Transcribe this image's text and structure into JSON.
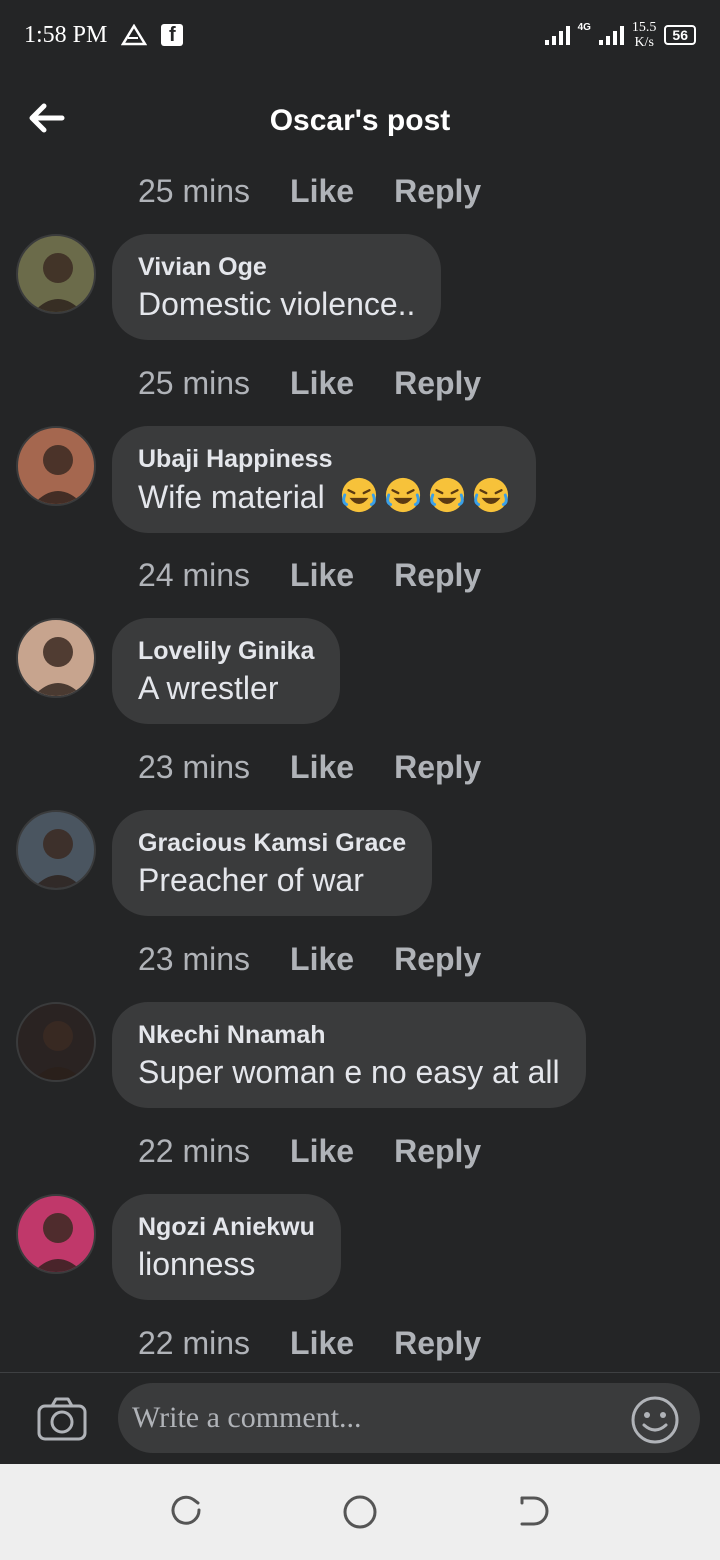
{
  "status_bar": {
    "time": "1:58 PM",
    "network": "4G",
    "speed_value": "15.5",
    "speed_unit": "K/s",
    "battery": "56"
  },
  "header": {
    "title": "Oscar's post",
    "back_icon": "arrow-left-icon"
  },
  "top_actions": {
    "time": "25 mins",
    "like": "Like",
    "reply": "Reply"
  },
  "comments": [
    {
      "name": "Vivian Oge",
      "text": "Domestic violence..",
      "time": "25 mins",
      "like": "Like",
      "reply": "Reply",
      "avatar_color": "#6b6b4a"
    },
    {
      "name": "Ubaji Happiness",
      "text": "Wife material ",
      "emoji": [
        "rolling-laughing-emoji",
        "rolling-laughing-emoji",
        "rolling-laughing-emoji",
        "rolling-laughing-emoji"
      ],
      "time": "24 mins",
      "like": "Like",
      "reply": "Reply",
      "avatar_color": "#a5674f"
    },
    {
      "name": "Lovelily Ginika",
      "text": "A wrestler",
      "time": "23 mins",
      "like": "Like",
      "reply": "Reply",
      "avatar_color": "#c7a48e"
    },
    {
      "name": "Gracious Kamsi Grace",
      "text": "Preacher of war",
      "time": "23 mins",
      "like": "Like",
      "reply": "Reply",
      "avatar_color": "#4a5560"
    },
    {
      "name": "Nkechi Nnamah",
      "text": "Super woman e no easy at all",
      "time": "22 mins",
      "like": "Like",
      "reply": "Reply",
      "avatar_color": "#2a2322"
    },
    {
      "name": "Ngozi Aniekwu",
      "text": "lionness",
      "time": "22 mins",
      "like": "Like",
      "reply": "Reply",
      "avatar_color": "#c0386a"
    }
  ],
  "composer": {
    "placeholder": "Write a comment...",
    "camera_icon": "camera-icon",
    "emoji_icon": "smiley-icon"
  },
  "colors": {
    "background": "#242526",
    "bubble": "#3a3b3c",
    "text": "#e4e6eb",
    "secondary_text": "#b0b3b8",
    "nav_bar": "#eeeeee"
  }
}
